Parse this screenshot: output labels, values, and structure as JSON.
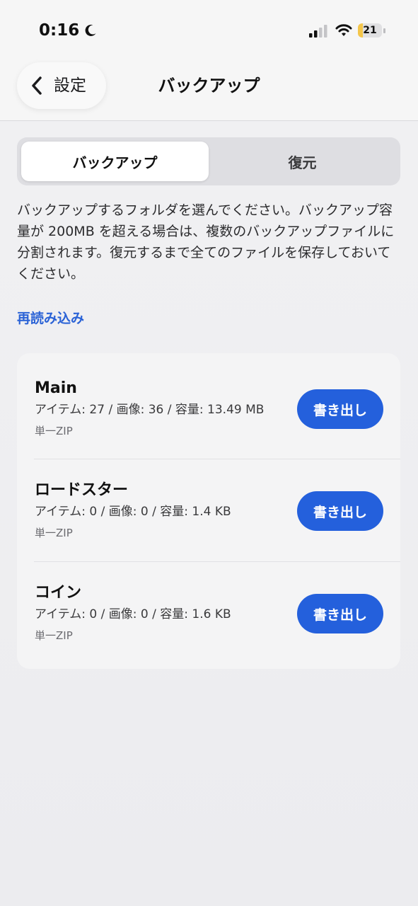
{
  "status_bar": {
    "time": "0:16",
    "battery_level": "21",
    "battery_fraction": 0.21
  },
  "nav": {
    "back_label": "設定",
    "title": "バックアップ"
  },
  "segments": {
    "backup": "バックアップ",
    "restore": "復元",
    "selected": "backup"
  },
  "description": "バックアップするフォルダを選んでください。バックアップ容量が 200MB を超える場合は、複数のバックアップファイルに分割されます。復元するまで全てのファイルを保存しておいてください。",
  "reload_label": "再読み込み",
  "folders": [
    {
      "name": "Main",
      "stats": "アイテム: 27 / 画像: 36 / 容量: 13.49 MB",
      "format": "単一ZIP",
      "button": "書き出し"
    },
    {
      "name": "ロードスター",
      "stats": "アイテム: 0 / 画像: 0 / 容量: 1.4 KB",
      "format": "単一ZIP",
      "button": "書き出し"
    },
    {
      "name": "コイン",
      "stats": "アイテム: 0 / 画像: 0 / 容量: 1.6 KB",
      "format": "単一ZIP",
      "button": "書き出し"
    }
  ],
  "colors": {
    "accent": "#2460dc",
    "link": "#2a62d6",
    "battery": "#f4c64a"
  }
}
